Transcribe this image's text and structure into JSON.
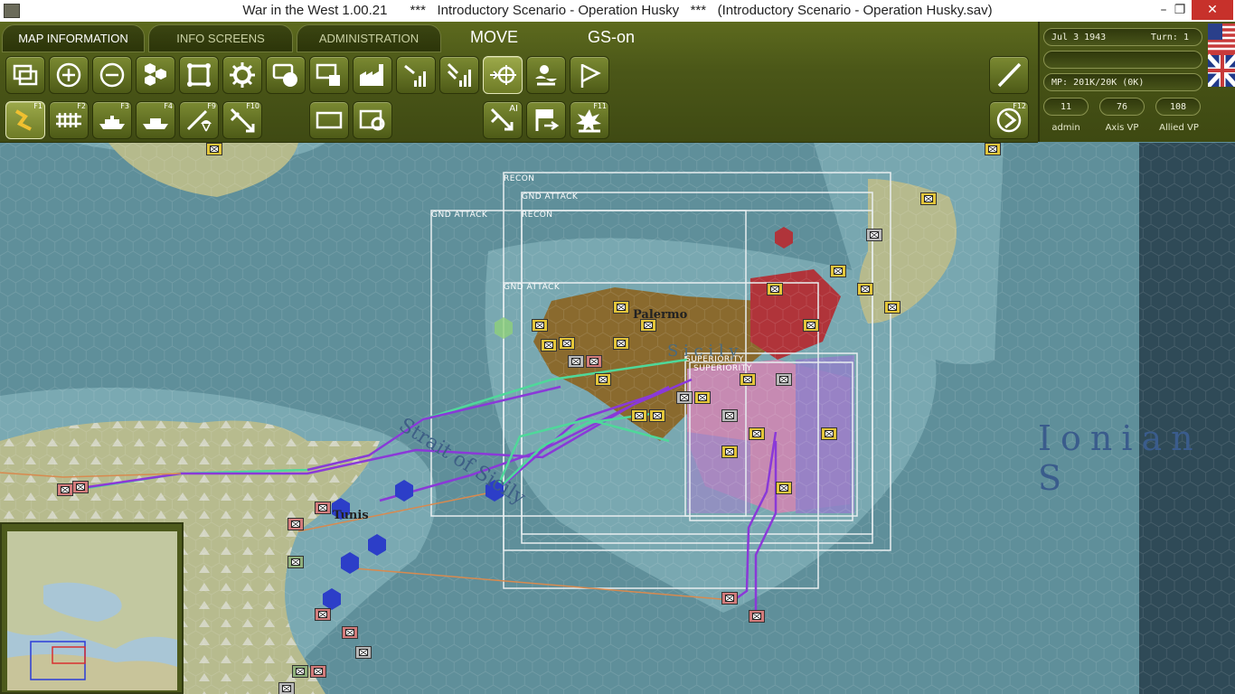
{
  "window": {
    "title": "War in the West 1.00.21      ***   Introductory Scenario - Operation Husky   ***   (Introductory Scenario - Operation Husky.sav)",
    "minimize": "–",
    "maximize": "❐",
    "close": "✕"
  },
  "tabs": [
    {
      "label": "MAP INFORMATION",
      "active": true
    },
    {
      "label": "INFO SCREENS",
      "active": false
    },
    {
      "label": "ADMINISTRATION",
      "active": false
    }
  ],
  "mode": {
    "move": "MOVE",
    "gs": "GS-on"
  },
  "toolbar": {
    "row1": [
      {
        "icon": "window-stack-icon"
      },
      {
        "icon": "zoom-in-icon"
      },
      {
        "icon": "zoom-out-icon"
      },
      {
        "icon": "hex-grid-icon"
      },
      {
        "icon": "unit-frame-icon"
      },
      {
        "icon": "gear-icon"
      },
      {
        "icon": "unit-counter-icon"
      },
      {
        "icon": "hq-icon"
      },
      {
        "icon": "factory-icon"
      },
      {
        "icon": "supply-signal-icon"
      },
      {
        "icon": "supply-signal-2-icon"
      },
      {
        "icon": "air-target-icon",
        "pressed": true
      },
      {
        "icon": "weather-icon"
      },
      {
        "icon": "flag-icon"
      },
      {
        "icon": "draw-line-icon"
      }
    ],
    "row2": [
      {
        "icon": "ground-move-icon",
        "fkey": "F1",
        "pressed": true
      },
      {
        "icon": "rail-move-icon",
        "fkey": "F2"
      },
      {
        "icon": "naval-move-icon",
        "fkey": "F3"
      },
      {
        "icon": "naval-transport-icon",
        "fkey": "F4"
      },
      {
        "icon": "airborne-icon",
        "fkey": "F9"
      },
      {
        "icon": "air-strike-icon",
        "fkey": "F10"
      },
      {
        "icon": "box-select-icon"
      },
      {
        "icon": "box-gear-icon"
      },
      {
        "icon": "air-ai-icon",
        "fkey": "AI"
      },
      {
        "icon": "retreat-flag-icon"
      },
      {
        "icon": "bombardment-icon",
        "fkey": "F11"
      },
      {
        "icon": "end-turn-icon",
        "fkey": "F12"
      }
    ]
  },
  "status": {
    "date": "Jul 3 1943",
    "turn": "Turn: 1",
    "blank": "",
    "mp": "MP: 201K/20K (0K)",
    "admin_value": "11",
    "admin_label": "admin",
    "axis_vp_value": "76",
    "axis_vp_label": "Axis VP",
    "allied_vp_value": "108",
    "allied_vp_label": "Allied VP"
  },
  "map": {
    "labels": {
      "palermo": "Palermo",
      "sicily": "S i c i l y",
      "strait": "Strait of Sicily",
      "tunis": "Tunis",
      "ionian": "Ionian S"
    },
    "boxes": {
      "recon1": "RECON",
      "gnd1": "GND ATTACK",
      "gnd2": "GND ATTACK",
      "recon2": "RECON",
      "gnd3": "GND ATTACK",
      "sup1": "SUPERIORITY",
      "sup2": "SUPERIORITY"
    }
  },
  "colors": {
    "sea_deep": "#5f8f9a",
    "sea_shallow": "#7fb0b9",
    "land": "#b9bd8f",
    "axis_territory": "#8a6a2e",
    "axis_red": "#b0343a",
    "allied_purple": "#8f80c8",
    "allied_pink": "#c88ab2",
    "route_green": "#4fd89a",
    "route_purple": "#8a39d8",
    "route_orange": "#d88a4f",
    "toolbar_olive": "#4b5718"
  }
}
